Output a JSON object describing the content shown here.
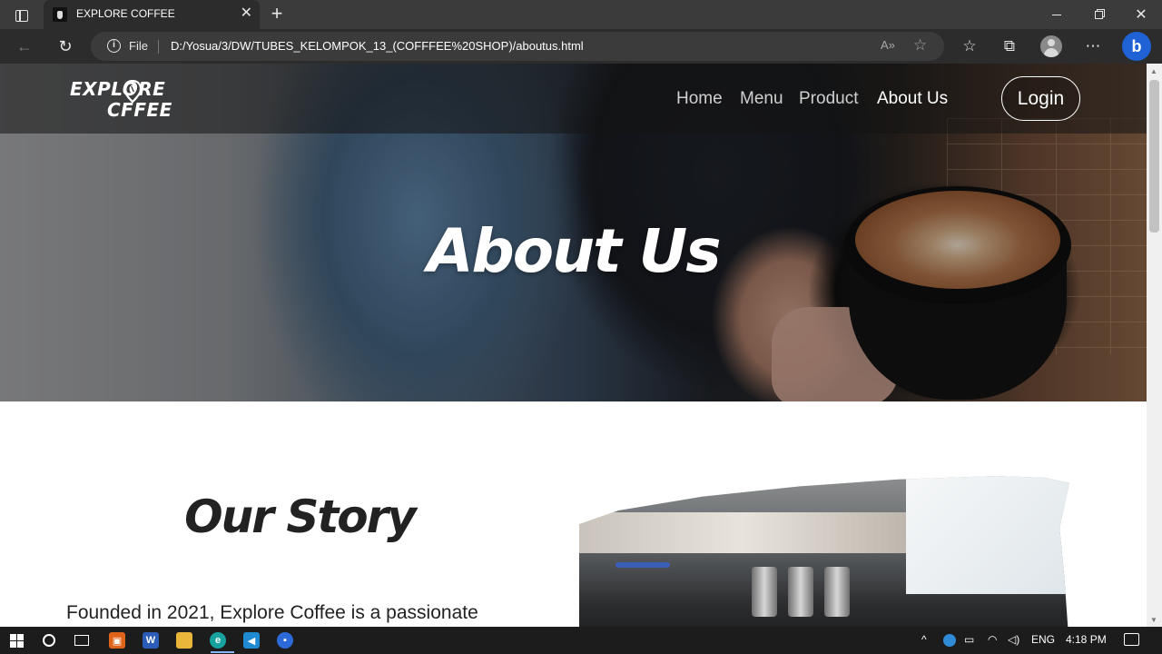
{
  "browser": {
    "tab_title": "EXPLORE COFFEE",
    "tab_close": "✕",
    "new_tab": "+",
    "address_scheme_label": "File",
    "address_url": "D:/Yosua/3/DW/TUBES_KELOMPOK_13_(COFFFEE%20SHOP)/aboutus.html",
    "icons": [
      "tab-actions-icon",
      "back-icon",
      "reload-icon",
      "info-icon",
      "read-aloud-icon",
      "add-favorite-icon",
      "favorites-icon",
      "collections-icon",
      "profile-icon",
      "more-icon",
      "bing-icon"
    ],
    "window_controls": {
      "minimize": "—",
      "maximize": "▢",
      "close": "✕"
    }
  },
  "site": {
    "logo_line1": "EXPLORE",
    "logo_line2": "CFFEE",
    "nav": [
      {
        "label": "Home",
        "active": false
      },
      {
        "label": "Menu",
        "active": false
      },
      {
        "label": "Product",
        "active": false
      },
      {
        "label": "About Us",
        "active": true
      }
    ],
    "login_label": "Login",
    "hero_title": "About Us",
    "story_title": "Our Story",
    "story_text": "Founded in 2021, Explore Coffee is a passionate"
  },
  "taskbar": {
    "language": "ENG",
    "time": "4:18 PM",
    "apps": [
      "html-editor-icon",
      "word-icon",
      "file-explorer-icon",
      "edge-icon",
      "vscode-icon",
      "zoom-icon"
    ]
  },
  "colors": {
    "accent_text": "#ffffff",
    "nav_inactive": "#cfcfcf",
    "heading_dark": "#222222"
  }
}
